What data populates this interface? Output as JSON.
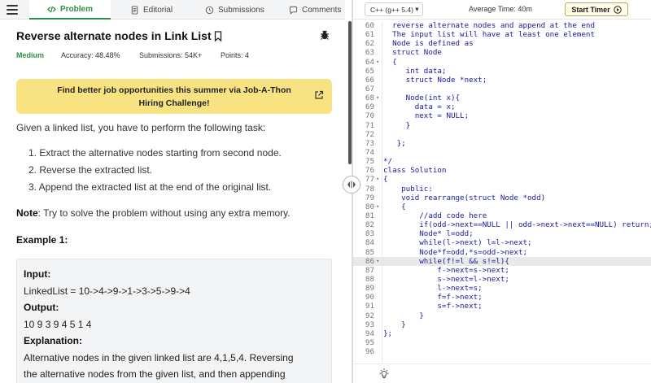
{
  "tabs": {
    "problem": "Problem",
    "editorial": "Editorial",
    "submissions": "Submissions",
    "comments": "Comments"
  },
  "problem": {
    "title": "Reverse alternate nodes in Link List",
    "difficulty": "Medium",
    "accuracy": "Accuracy: 48.48%",
    "submissions": "Submissions: 54K+",
    "points": "Points: 4",
    "banner": "Find better job opportunities this summer via Job-A-Thon Hiring Challenge!",
    "intro": "Given a linked list, you have to perform the following task:",
    "steps": [
      "1. Extract the alternative nodes starting from second node.",
      "2. Reverse the extracted list.",
      "3. Append the extracted list at the end of the original list."
    ],
    "note_label": "Note",
    "note_text": ": Try to solve the problem without using any extra memory.",
    "example_title": "Example 1:",
    "example": {
      "input_label": "Input:",
      "input": "LinkedList = 10->4->9->1->3->5->9->4",
      "output_label": "Output:",
      "output": "10 9 3 9 4 5 1 4",
      "explanation_label": "Explanation:",
      "explanation_1": "Alternative nodes in the given linked list are 4,1,5,4. Reversing",
      "explanation_2": "the alternative nodes from the given list, and then appending"
    }
  },
  "editor": {
    "language": "C++ (g++ 5.4)",
    "average_time": "Average Time: 40m",
    "timer_label": "Start Timer",
    "lines": [
      {
        "n": "60",
        "f": "",
        "t": "  reverse alternate nodes and append at the end"
      },
      {
        "n": "61",
        "f": "",
        "t": "  The input list will have at least one element"
      },
      {
        "n": "62",
        "f": "",
        "t": "  Node is defined as"
      },
      {
        "n": "63",
        "f": "",
        "t": "  struct Node"
      },
      {
        "n": "64",
        "f": "▾",
        "t": "  {"
      },
      {
        "n": "65",
        "f": "",
        "t": "     int data;"
      },
      {
        "n": "66",
        "f": "",
        "t": "     struct Node *next;"
      },
      {
        "n": "67",
        "f": "",
        "t": ""
      },
      {
        "n": "68",
        "f": "▾",
        "t": "     Node(int x){"
      },
      {
        "n": "69",
        "f": "",
        "t": "       data = x;"
      },
      {
        "n": "70",
        "f": "",
        "t": "       next = NULL;"
      },
      {
        "n": "71",
        "f": "",
        "t": "     }"
      },
      {
        "n": "72",
        "f": "",
        "t": ""
      },
      {
        "n": "73",
        "f": "",
        "t": "   };"
      },
      {
        "n": "74",
        "f": "",
        "t": ""
      },
      {
        "n": "75",
        "f": "",
        "t": "*/"
      },
      {
        "n": "76",
        "f": "",
        "t": "class Solution"
      },
      {
        "n": "77",
        "f": "▾",
        "t": "{"
      },
      {
        "n": "78",
        "f": "",
        "t": "    public:"
      },
      {
        "n": "79",
        "f": "",
        "t": "    void rearrange(struct Node *odd)"
      },
      {
        "n": "80",
        "f": "▾",
        "t": "    {"
      },
      {
        "n": "81",
        "f": "",
        "t": "        //add code here"
      },
      {
        "n": "82",
        "f": "",
        "t": "        if(odd->next==NULL || odd->next->next==NULL) return;"
      },
      {
        "n": "83",
        "f": "",
        "t": "        Node* l=odd;"
      },
      {
        "n": "84",
        "f": "",
        "t": "        while(l->next) l=l->next;"
      },
      {
        "n": "85",
        "f": "",
        "t": "        Node*f=odd,*s=odd->next;"
      },
      {
        "n": "86",
        "f": "▾",
        "t": "        while(f!=l && s!=l){"
      },
      {
        "n": "87",
        "f": "",
        "t": "            f->next=s->next;"
      },
      {
        "n": "88",
        "f": "",
        "t": "            s->next=l->next;"
      },
      {
        "n": "89",
        "f": "",
        "t": "            l->next=s;"
      },
      {
        "n": "90",
        "f": "",
        "t": "            f=f->next;"
      },
      {
        "n": "91",
        "f": "",
        "t": "            s=f->next;"
      },
      {
        "n": "92",
        "f": "",
        "t": "        }"
      },
      {
        "n": "93",
        "f": "",
        "t": "    }"
      },
      {
        "n": "94",
        "f": "",
        "t": "};"
      },
      {
        "n": "95",
        "f": "",
        "t": ""
      },
      {
        "n": "96",
        "f": "",
        "t": ""
      }
    ],
    "highlighted_line": "86"
  },
  "colors": {
    "accent": "#2f8d46",
    "banner": "#f8e382",
    "code_text": "#1a1a9e"
  },
  "icons": [
    "menu-icon",
    "code-icon",
    "document-icon",
    "clock-icon",
    "comment-icon",
    "bookmark-icon",
    "bug-icon",
    "external-link-icon",
    "drag-handle-icon",
    "play-circle-icon",
    "lightbulb-icon"
  ]
}
